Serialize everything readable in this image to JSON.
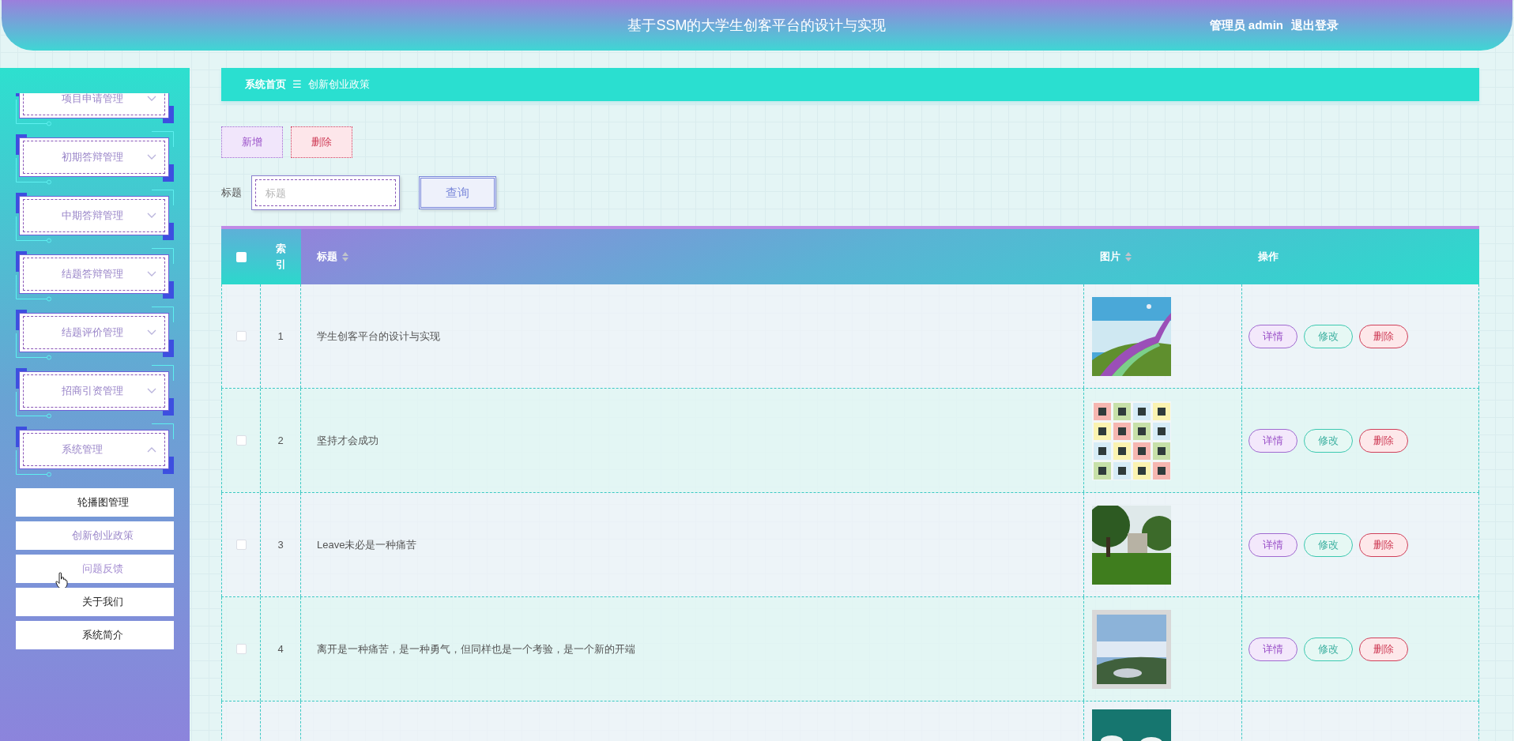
{
  "header": {
    "title": "基于SSM的大学生创客平台的设计与实现",
    "user": "管理员 admin",
    "logout": "退出登录"
  },
  "sidebar": {
    "groups": [
      {
        "label": "项目申请管理",
        "expanded": false
      },
      {
        "label": "初期答辩管理",
        "expanded": false
      },
      {
        "label": "中期答辩管理",
        "expanded": false
      },
      {
        "label": "结题答辩管理",
        "expanded": false
      },
      {
        "label": "结题评价管理",
        "expanded": false
      },
      {
        "label": "招商引资管理",
        "expanded": false
      },
      {
        "label": "系统管理",
        "expanded": true,
        "children": [
          {
            "label": "轮播图管理",
            "selected": false,
            "hovered": false
          },
          {
            "label": "创新创业政策",
            "selected": true,
            "hovered": false
          },
          {
            "label": "问题反馈",
            "selected": false,
            "hovered": true
          },
          {
            "label": "关于我们",
            "selected": false,
            "hovered": false
          },
          {
            "label": "系统简介",
            "selected": false,
            "hovered": false
          }
        ]
      }
    ]
  },
  "breadcrumb": {
    "home": "系统首页",
    "separator": "☰",
    "current": "创新创业政策"
  },
  "toolbar": {
    "add": "新增",
    "delete": "删除"
  },
  "search": {
    "label": "标题",
    "placeholder": "标题",
    "button": "查询"
  },
  "table": {
    "select_all": {
      "checked": false
    },
    "columns": [
      {
        "label": "索引",
        "kind": "index"
      },
      {
        "label": "标题",
        "kind": "sortable"
      },
      {
        "label": "图片",
        "kind": "sortable"
      },
      {
        "label": "操作",
        "kind": "plain"
      }
    ],
    "rows": [
      {
        "checked": false,
        "index": "1",
        "title": "学生创客平台的设计与实现",
        "picture": {
          "kind": "picture"
        },
        "actions": [
          "详情",
          "修改",
          "删除"
        ]
      },
      {
        "checked": false,
        "index": "2",
        "title": "坚持才会成功",
        "picture": {
          "kind": "picture"
        },
        "actions": [
          "详情",
          "修改",
          "删除"
        ]
      },
      {
        "checked": false,
        "index": "3",
        "title": "Leave未必是一种痛苦",
        "picture": {
          "kind": "picture"
        },
        "actions": [
          "详情",
          "修改",
          "删除"
        ]
      },
      {
        "checked": false,
        "index": "4",
        "title": "离开是一种痛苦，是一种勇气，但同样也是一个考验，是一个新的开端",
        "picture": {
          "kind": "picture"
        },
        "actions": [
          "详情",
          "修改",
          "删除"
        ]
      }
    ],
    "cut_row": {
      "picture": {
        "kind": "picture"
      }
    }
  }
}
